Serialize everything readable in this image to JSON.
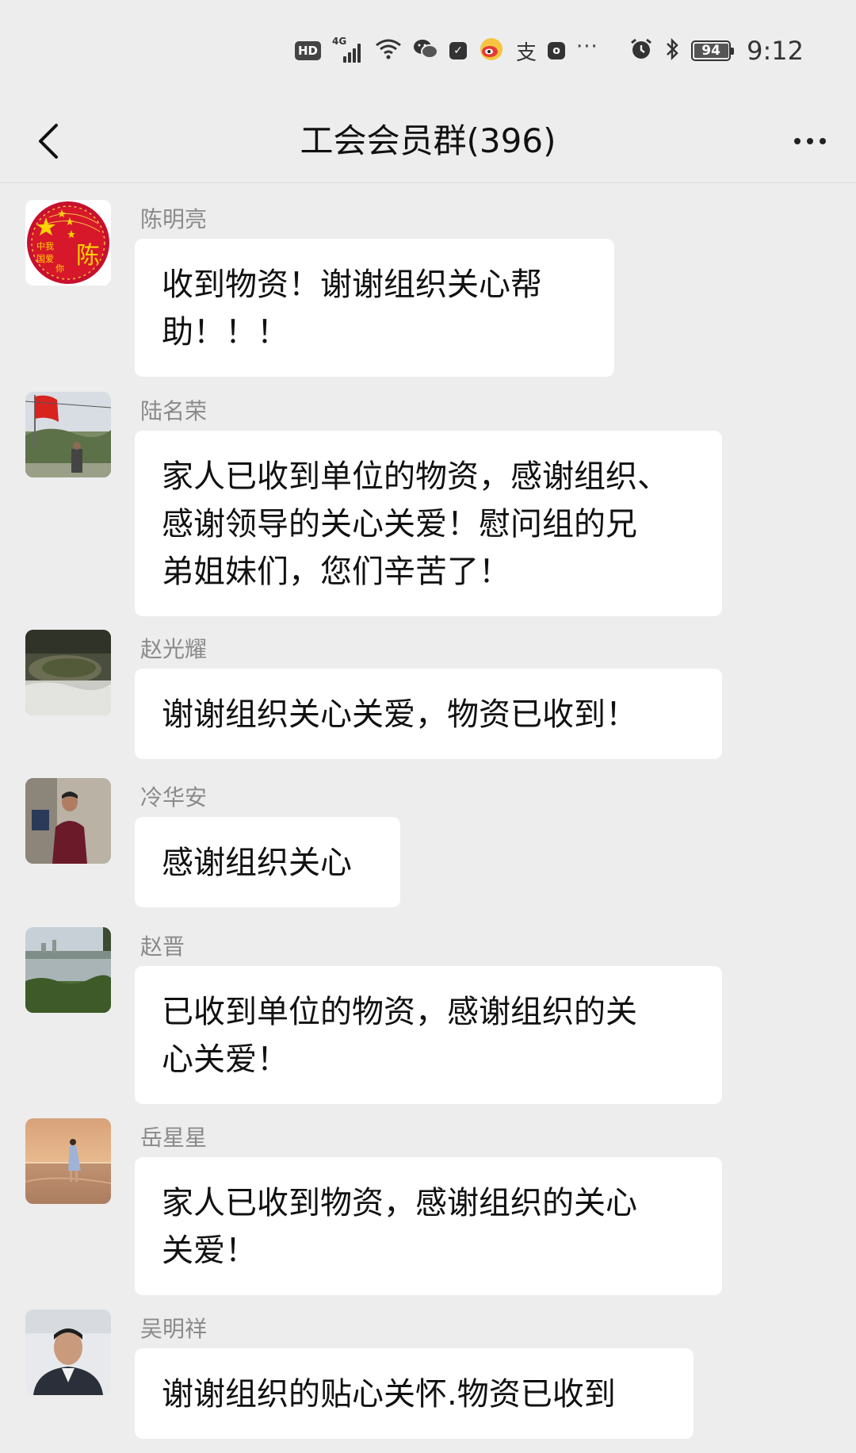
{
  "status_bar": {
    "hd_label": "HD",
    "network_label": "4G",
    "battery": "94",
    "time": "9:12",
    "icons": [
      "hd-icon",
      "signal-icon",
      "wifi-icon",
      "wechat-icon",
      "app-icon",
      "weibo-icon",
      "alipay-icon",
      "app2-icon",
      "more-notifications-icon",
      "alarm-icon",
      "bluetooth-icon",
      "battery-icon"
    ]
  },
  "header": {
    "title": "工会会员群(396)",
    "back_icon": "chevron-left-icon",
    "more_icon": "more-dots-icon"
  },
  "messages": [
    {
      "sender": "陈明亮",
      "text": "收到物资！谢谢组织关心帮助！！！",
      "lines": [
        "收到物资！谢谢组织关心帮",
        "助！！！"
      ]
    },
    {
      "sender": "陆名荣",
      "text": "家人已收到单位的物资，感谢组织、感谢领导的关心关爱！慰问组的兄弟姐妹们，您们辛苦了！",
      "lines": [
        "家人已收到单位的物资，感谢组织、",
        "感谢领导的关心关爱！慰问组的兄",
        "弟姐妹们，您们辛苦了！"
      ]
    },
    {
      "sender": "赵光耀",
      "text": "谢谢组织关心关爱，物资已收到！",
      "lines": [
        "谢谢组织关心关爱，物资已收到！"
      ]
    },
    {
      "sender": "冷华安",
      "text": "感谢组织关心",
      "lines": [
        "感谢组织关心"
      ]
    },
    {
      "sender": "赵晋",
      "text": "已收到单位的物资，感谢组织的关心关爱！",
      "lines": [
        "已收到单位的物资，感谢组织的关",
        "心关爱！"
      ]
    },
    {
      "sender": "岳星星",
      "text": "家人已收到物资，感谢组织的关心关爱！",
      "lines": [
        "家人已收到物资，感谢组织的关心",
        "关爱！"
      ]
    },
    {
      "sender": "吴明祥",
      "text": "谢谢组织的贴心关怀.物资已收到",
      "lines": [
        "谢谢组织的贴心关怀.物资已收到"
      ]
    }
  ],
  "avatar_text": {
    "chen_line1": "中我",
    "chen_line2": "国爱",
    "chen_line3": "你",
    "chen_char": "陈"
  },
  "colors": {
    "background": "#ededed",
    "bubble": "#ffffff",
    "sender_name": "#8a8a8a",
    "text": "#111111"
  }
}
